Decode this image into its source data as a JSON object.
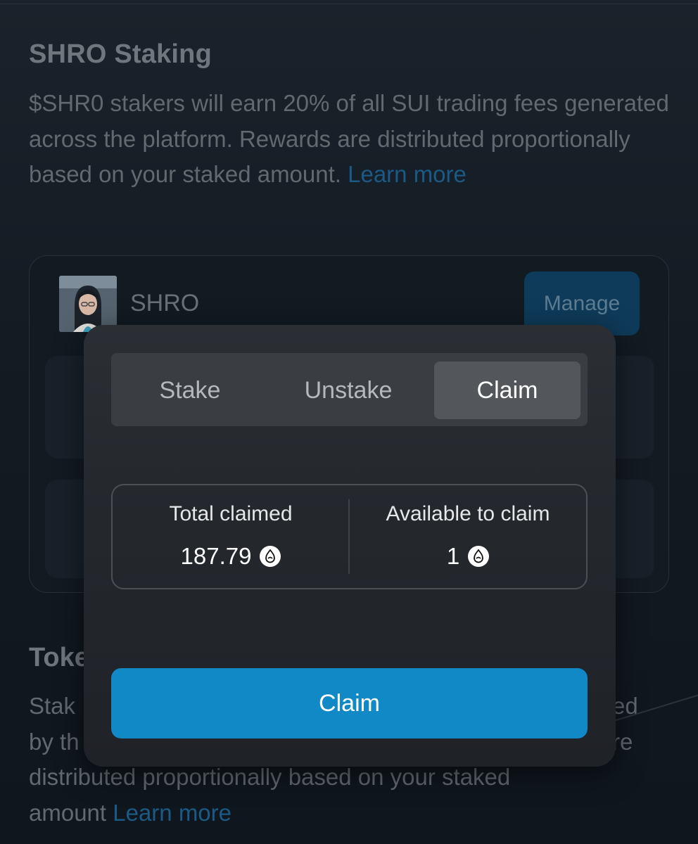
{
  "staking": {
    "title": "SHRO Staking",
    "description": "$SHR0 stakers will earn 20% of all SUI trading fees generated across the platform. Rewards are distributed proportionally based on your staked amount.",
    "learn_more": "Learn more"
  },
  "token": {
    "name": "SHRO",
    "manage_label": "Manage"
  },
  "section2": {
    "title_visible": "Toke",
    "line1_left": "Stak",
    "line1_right": "ed",
    "line2_left": "by th",
    "line2_right": "re",
    "line3": "distributed proportionally based on your staked",
    "line4_text": "amount",
    "learn_more": "Learn more"
  },
  "modal": {
    "tabs": [
      {
        "label": "Stake",
        "active": false
      },
      {
        "label": "Unstake",
        "active": false
      },
      {
        "label": "Claim",
        "active": true
      }
    ],
    "stats": {
      "total_claimed_label": "Total claimed",
      "total_claimed_value": "187.79",
      "available_label": "Available to claim",
      "available_value": "1",
      "currency_icon": "sui-drop-icon"
    },
    "claim_button_label": "Claim"
  },
  "colors": {
    "accent": "#1189c7",
    "link": "#1b5a85",
    "modal_bg": "#25292e"
  }
}
